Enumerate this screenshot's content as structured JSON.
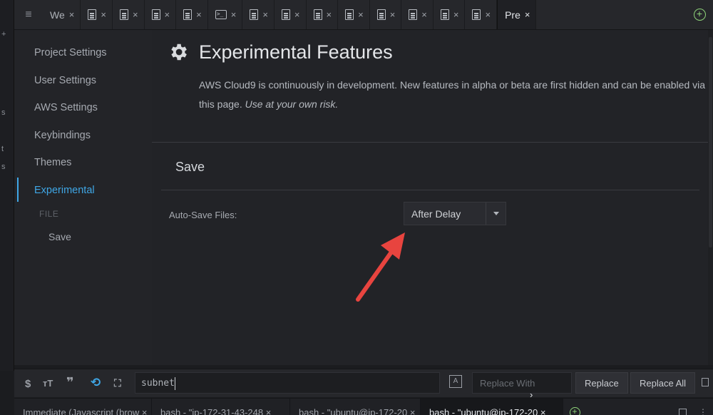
{
  "tabs": [
    {
      "label": "We",
      "icon": "none"
    },
    {
      "label": "",
      "icon": "file-icon"
    },
    {
      "label": "",
      "icon": "file-icon"
    },
    {
      "label": "",
      "icon": "file-icon"
    },
    {
      "label": "",
      "icon": "file-icon"
    },
    {
      "label": "",
      "icon": "terminal-icon"
    },
    {
      "label": "",
      "icon": "file-icon"
    },
    {
      "label": "",
      "icon": "file-icon"
    },
    {
      "label": "",
      "icon": "file-icon"
    },
    {
      "label": "",
      "icon": "file-icon"
    },
    {
      "label": "",
      "icon": "file-icon"
    },
    {
      "label": "",
      "icon": "file-icon"
    },
    {
      "label": "",
      "icon": "file-icon"
    },
    {
      "label": "",
      "icon": "file-icon"
    },
    {
      "label": "Pre",
      "icon": "none",
      "active": true
    }
  ],
  "tab_close": "×",
  "sidebar": {
    "items": [
      {
        "label": "Project Settings"
      },
      {
        "label": "User Settings"
      },
      {
        "label": "AWS Settings"
      },
      {
        "label": "Keybindings"
      },
      {
        "label": "Themes"
      },
      {
        "label": "Experimental",
        "active": true
      }
    ],
    "section": "FILE",
    "sub_items": [
      "Save"
    ]
  },
  "main": {
    "title": "Experimental Features",
    "description": "AWS Cloud9 is continuously in development. New features in alpha or beta are first hidden and can be enabled via this page.",
    "description_em": "Use at your own risk.",
    "section_title": "Save",
    "auto_save_label": "Auto-Save Files:",
    "auto_save_value": "After Delay"
  },
  "findbar": {
    "search_value": "subnet",
    "replace_placeholder": "Replace With",
    "replace_button": "Replace",
    "replace_all_button": "Replace All",
    "prev_next": "‹ ›"
  },
  "terminal_tabs": [
    {
      "label": "Immediate (Javascript (brow ×"
    },
    {
      "label": "bash - \"ip-172-31-43-248 ×"
    },
    {
      "label": "bash - \"ubuntu@ip-172-20 ×"
    },
    {
      "label": "bash - \"ubuntu@ip-172-20 ×",
      "active": true
    }
  ],
  "colors": {
    "accent": "#3fa7e6",
    "add_green": "#8fd47a",
    "annotation_arrow": "#e8443f"
  }
}
